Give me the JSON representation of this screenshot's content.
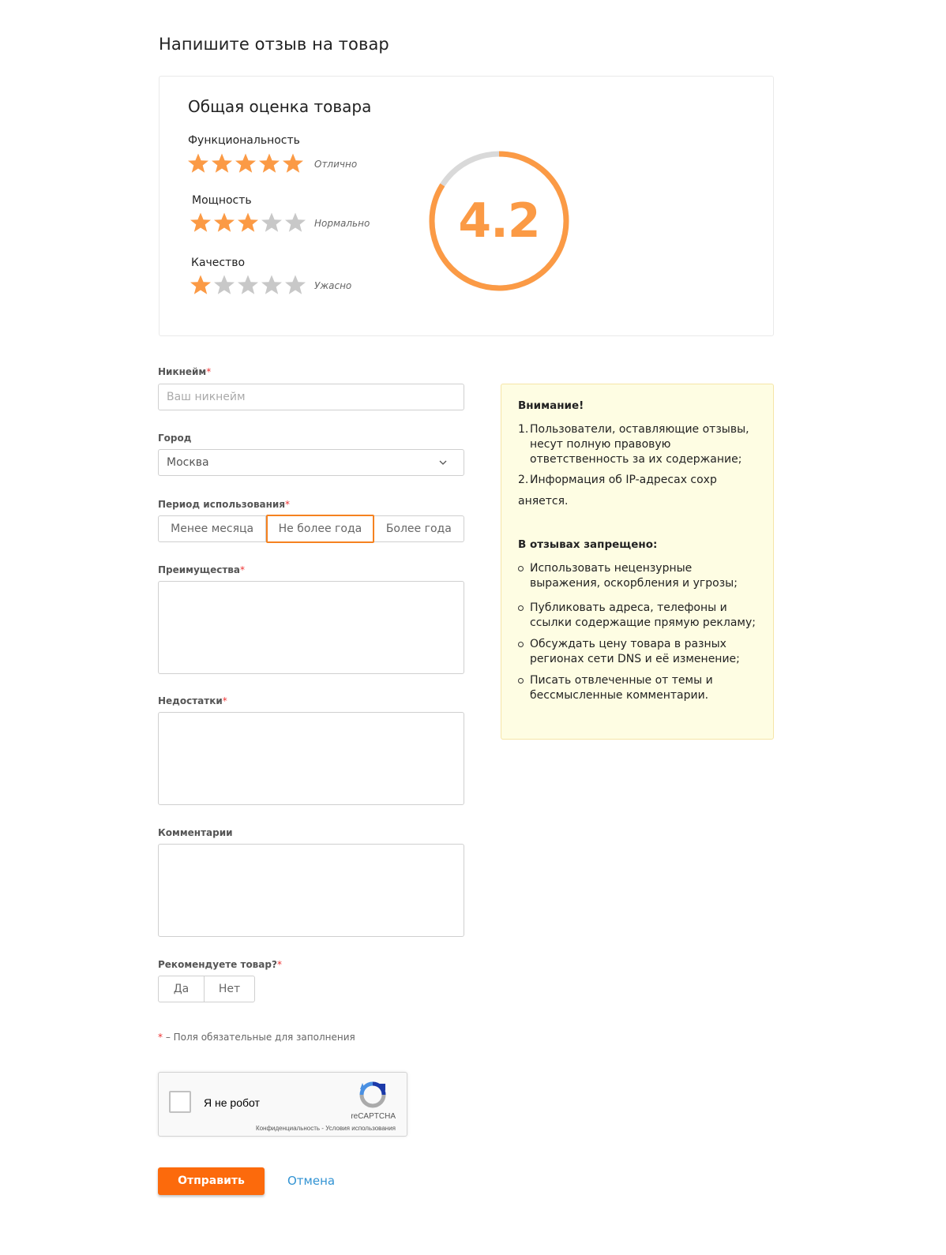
{
  "page": {
    "title": "Напишите отзыв на товар"
  },
  "rating": {
    "title": "Общая оценка товара",
    "overall": "4.2",
    "overall_value": 4.2,
    "overall_max": 5,
    "criteria": [
      {
        "label": "Функциональность",
        "stars": 5,
        "max": 5,
        "verdict": "Отлично"
      },
      {
        "label": "Мощность",
        "stars": 3,
        "max": 5,
        "verdict": "Нормально"
      },
      {
        "label": "Качество",
        "stars": 1,
        "max": 5,
        "verdict": "Ужасно"
      }
    ],
    "colors": {
      "accent": "#fb9a45",
      "inactive": "#c8c8c8"
    }
  },
  "form": {
    "nickname": {
      "label": "Никнейм",
      "required_mark": "*",
      "placeholder": "Ваш никнейм",
      "value": ""
    },
    "city": {
      "label": "Город",
      "value": "Москва"
    },
    "period": {
      "label": "Период использования",
      "required_mark": "*",
      "options": [
        "Менее месяца",
        "Не более года",
        "Более года"
      ],
      "selected": "Не более года"
    },
    "pros": {
      "label": "Преимущества",
      "required_mark": "*",
      "value": ""
    },
    "cons": {
      "label": "Недостатки",
      "required_mark": "*",
      "value": ""
    },
    "comments": {
      "label": "Комментарии",
      "value": ""
    },
    "recommend": {
      "label": "Рекомендуете товар?",
      "required_mark": "*",
      "options": [
        "Да",
        "Нет"
      ]
    },
    "required_note": {
      "mark": "*",
      "text": " – Поля обязательные для заполнения"
    },
    "captcha": {
      "label": "Я не робот",
      "brand": "reCAPTCHA",
      "links": "Конфиденциальность - Условия использования"
    },
    "submit_label": "Отправить",
    "cancel_label": "Отмена"
  },
  "notice": {
    "title": "Внимание!",
    "items": [
      {
        "num": "1.",
        "text": "Пользователи, оставляющие отзывы, несут полную правовую ответственность за их содержание;"
      },
      {
        "num": "2.",
        "text": "Информация об IP-адресах сохр"
      }
    ],
    "item2_wrap": "аняется.",
    "prohibited_title": "В отзывах запрещено:",
    "prohibited": [
      "Использовать нецензурные выражения, оскорбления и угрозы;",
      "Публиковать адреса, телефоны и ссылки содержащие прямую рекламу;",
      "Обсуждать цену товара в разных регионах сети DNS и её изменение;",
      "Писать отвлеченные от темы и бессмысленные комментарии."
    ]
  }
}
